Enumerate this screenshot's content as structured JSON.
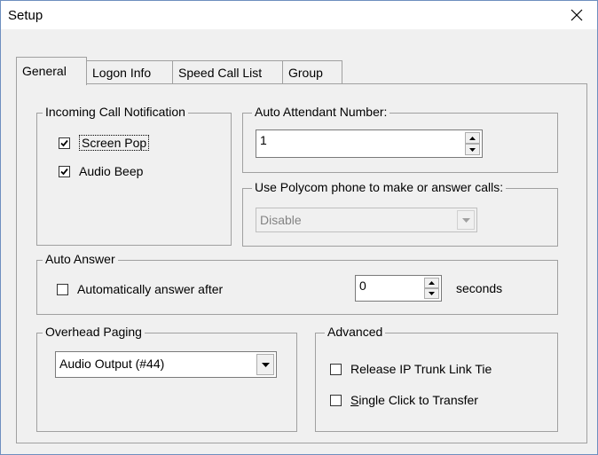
{
  "window": {
    "title": "Setup"
  },
  "tabs": [
    {
      "label": "General"
    },
    {
      "label": "Logon Info"
    },
    {
      "label": "Speed Call List"
    },
    {
      "label": "Group"
    }
  ],
  "incoming": {
    "legend": "Incoming Call Notification",
    "screen_pop": {
      "label": "Screen Pop",
      "checked": true
    },
    "audio_beep": {
      "label": "Audio Beep",
      "checked": true
    }
  },
  "auto_attendant": {
    "legend": "Auto Attendant Number:",
    "value": "1"
  },
  "polycom": {
    "legend": "Use Polycom phone to make or answer calls:",
    "value": "Disable"
  },
  "auto_answer": {
    "legend": "Auto Answer",
    "checkbox_label": "Automatically answer after",
    "checked": false,
    "value": "0",
    "unit": "seconds"
  },
  "overhead": {
    "legend": "Overhead Paging",
    "value": "Audio Output (#44)"
  },
  "advanced": {
    "legend": "Advanced",
    "release_trunk": {
      "label": "Release IP Trunk Link Tie",
      "checked": false
    },
    "single_click": {
      "label_prefix": "S",
      "label_rest": "ingle Click to Transfer",
      "checked": false
    }
  }
}
